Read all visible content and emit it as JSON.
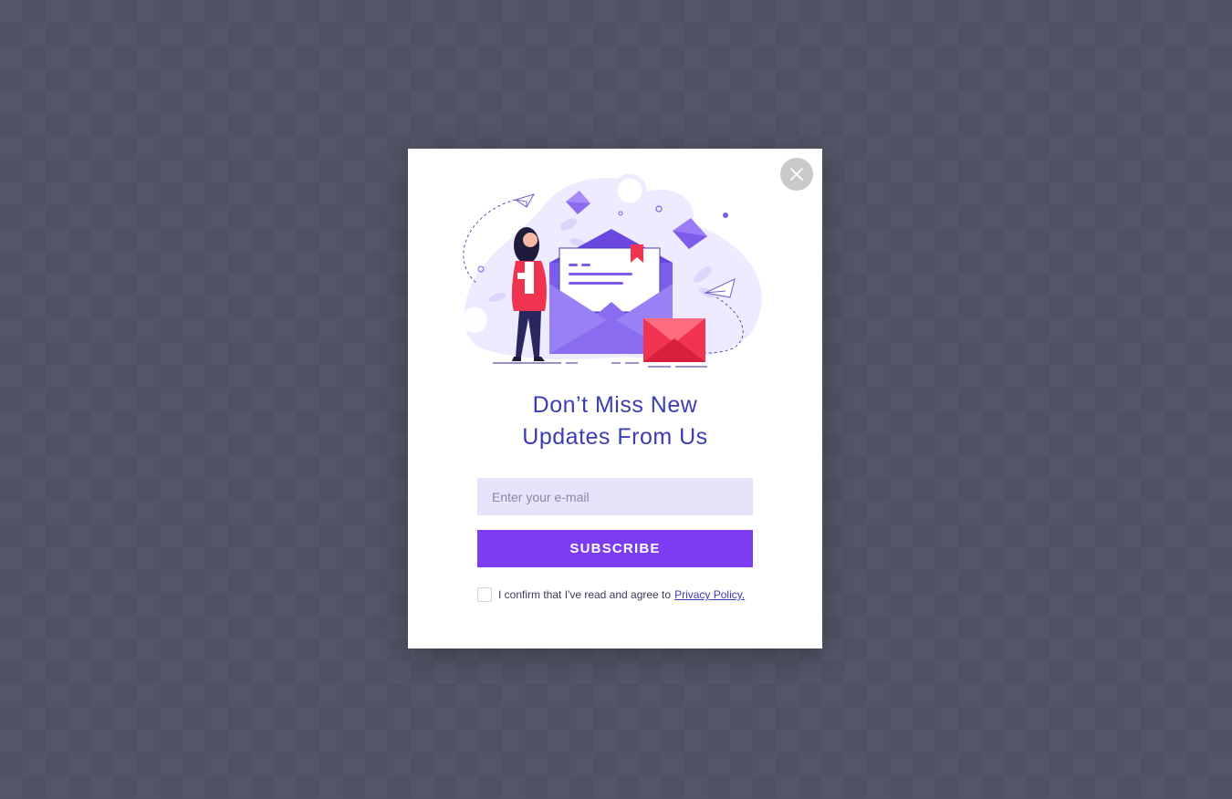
{
  "popup": {
    "headline_line1": "Don’t Miss New",
    "headline_line2": "Updates From Us",
    "email_placeholder": "Enter your e-mail",
    "email_value": "",
    "subscribe_label": "SUBSCRIBE",
    "consent_text": "I confirm that I've read and agree to",
    "privacy_link": "Privacy Policy.",
    "close_icon": "close-icon",
    "illustration": "newsletter-envelope-illustration"
  },
  "colors": {
    "accent": "#7b3cf3",
    "headline": "#3b3db5",
    "input_bg": "#e8e3fb",
    "envelope_red": "#f0334f"
  }
}
